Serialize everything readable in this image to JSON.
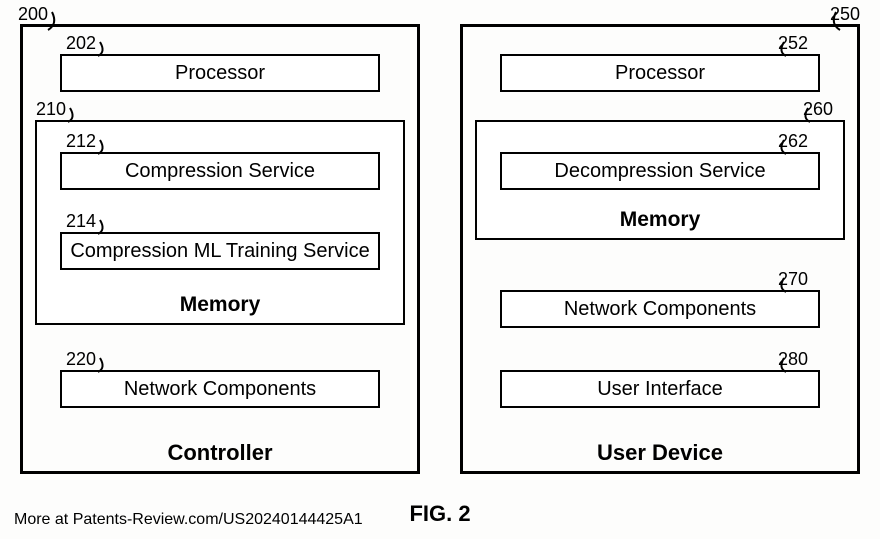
{
  "figure": {
    "label": "FIG. 2",
    "footer": "More at Patents-Review.com/US20240144425A1"
  },
  "controller": {
    "ref": "200",
    "title": "Controller",
    "processor": {
      "ref": "202",
      "label": "Processor"
    },
    "memory": {
      "ref": "210",
      "label": "Memory",
      "compression": {
        "ref": "212",
        "label": "Compression Service"
      },
      "training": {
        "ref": "214",
        "label": "Compression ML Training Service"
      }
    },
    "network": {
      "ref": "220",
      "label": "Network Components"
    }
  },
  "userdevice": {
    "ref": "250",
    "title": "User Device",
    "processor": {
      "ref": "252",
      "label": "Processor"
    },
    "memory": {
      "ref": "260",
      "label": "Memory",
      "decompression": {
        "ref": "262",
        "label": "Decompression Service"
      }
    },
    "network": {
      "ref": "270",
      "label": "Network Components"
    },
    "ui": {
      "ref": "280",
      "label": "User Interface"
    }
  }
}
